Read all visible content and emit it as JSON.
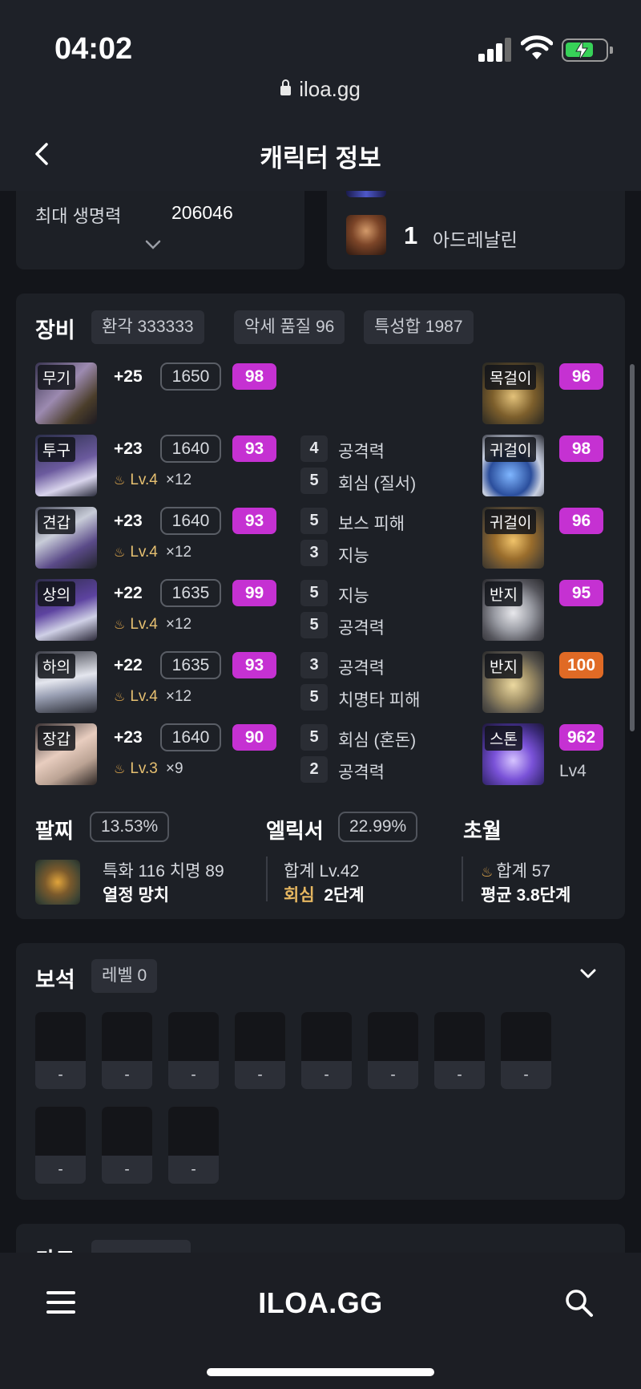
{
  "status_bar": {
    "time": "04:02"
  },
  "browser": {
    "url": "iloa.gg"
  },
  "header": {
    "title": "캐릭터 정보",
    "back_icon": "chevron-left-icon"
  },
  "hp_card": {
    "label": "최대 생명력",
    "value": "206046"
  },
  "engraving_card": {
    "count": "1",
    "name": "아드레날린"
  },
  "equipment": {
    "title": "장비",
    "chips": [
      "환각 333333",
      "악세 품질 96",
      "특성합 1987"
    ],
    "armor": [
      {
        "slot": "무기",
        "honing": "+25",
        "ilvl": "1650",
        "quality": "98"
      },
      {
        "slot": "투구",
        "honing": "+23",
        "ilvl": "1640",
        "quality": "93",
        "elixir_lv": "Lv.4",
        "elixir_mult": "×12"
      },
      {
        "slot": "견갑",
        "honing": "+23",
        "ilvl": "1640",
        "quality": "93",
        "elixir_lv": "Lv.4",
        "elixir_mult": "×12"
      },
      {
        "slot": "상의",
        "honing": "+22",
        "ilvl": "1635",
        "quality": "99",
        "elixir_lv": "Lv.4",
        "elixir_mult": "×12"
      },
      {
        "slot": "하의",
        "honing": "+22",
        "ilvl": "1635",
        "quality": "93",
        "elixir_lv": "Lv.4",
        "elixir_mult": "×12"
      },
      {
        "slot": "장갑",
        "honing": "+23",
        "ilvl": "1640",
        "quality": "90",
        "elixir_lv": "Lv.3",
        "elixir_mult": "×9"
      }
    ],
    "stats": [
      {
        "num": "4",
        "name": "공격력"
      },
      {
        "num": "5",
        "name": "회심 (질서)"
      },
      {
        "num": "5",
        "name": "보스 피해"
      },
      {
        "num": "3",
        "name": "지능"
      },
      {
        "num": "5",
        "name": "지능"
      },
      {
        "num": "5",
        "name": "공격력"
      },
      {
        "num": "3",
        "name": "공격력"
      },
      {
        "num": "5",
        "name": "치명타 피해"
      },
      {
        "num": "5",
        "name": "회심 (혼돈)"
      },
      {
        "num": "2",
        "name": "공격력"
      }
    ],
    "accessories": [
      {
        "slot": "목걸이",
        "quality": "96"
      },
      {
        "slot": "귀걸이",
        "quality": "98"
      },
      {
        "slot": "귀걸이",
        "quality": "96"
      },
      {
        "slot": "반지",
        "quality": "95"
      },
      {
        "slot": "반지",
        "quality": "100"
      },
      {
        "slot": "스톤",
        "quality": "962",
        "sub": "Lv4"
      }
    ],
    "bracelet": {
      "title": "팔찌",
      "pct": "13.53%",
      "line1": "특화 116  치명 89",
      "line2": "열정  망치"
    },
    "elixir": {
      "title": "엘릭서",
      "pct": "22.99%",
      "line1": "합계 Lv.42",
      "line2_a": "회심",
      "line2_b": "2단계"
    },
    "transcend": {
      "title": "초월",
      "line1": "합계 57",
      "line2": "평균 3.8단계"
    }
  },
  "gems": {
    "title": "보석",
    "level_chip": "레벨 0",
    "slots": [
      "-",
      "-",
      "-",
      "-",
      "-",
      "-",
      "-",
      "-",
      "-",
      "-",
      "-"
    ]
  },
  "cards": {
    "title": "카드"
  },
  "bottom_nav": {
    "logo": "ILOA.GG"
  },
  "colors": {
    "quality_purple": "#c531d2",
    "quality_orange": "#e06a25",
    "background": "#13151a",
    "card": "#1d2026"
  }
}
